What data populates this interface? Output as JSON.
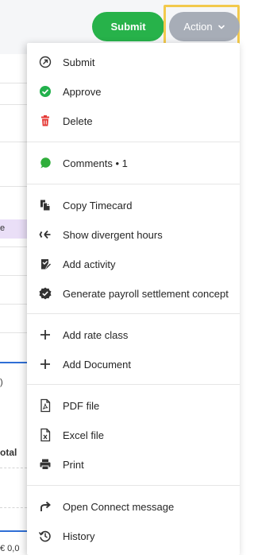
{
  "header": {
    "submit_label": "Submit",
    "action_label": "Action"
  },
  "background": {
    "fragment_e": "e",
    "fragment_zero": ")",
    "fragment_total": "otal",
    "fragment_euro": "€ 0,0"
  },
  "menu": {
    "items": [
      {
        "label": "Submit",
        "icon": "arrow-circle-icon"
      },
      {
        "label": "Approve",
        "icon": "check-circle-icon"
      },
      {
        "label": "Delete",
        "icon": "trash-icon"
      },
      {
        "label": "Comments • 1",
        "icon": "comment-icon"
      },
      {
        "label": "Copy Timecard",
        "icon": "copy-icon"
      },
      {
        "label": "Show divergent hours",
        "icon": "divergent-icon"
      },
      {
        "label": "Add activity",
        "icon": "add-activity-icon"
      },
      {
        "label": "Generate payroll settlement concept",
        "icon": "verified-badge-icon"
      },
      {
        "label": "Add rate class",
        "icon": "plus-icon"
      },
      {
        "label": "Add Document",
        "icon": "plus-icon"
      },
      {
        "label": "PDF file",
        "icon": "pdf-file-icon"
      },
      {
        "label": "Excel file",
        "icon": "excel-file-icon"
      },
      {
        "label": "Print",
        "icon": "print-icon"
      },
      {
        "label": "Open Connect message",
        "icon": "share-arrow-icon"
      },
      {
        "label": "History",
        "icon": "history-icon"
      }
    ]
  },
  "colors": {
    "submit_green": "#27b24a",
    "action_gray": "#a7adb7",
    "highlight_yellow": "#f2c94c",
    "approve_green": "#22b14c",
    "delete_red": "#e53935",
    "comment_green": "#2fae3b",
    "accent_blue": "#2f6fd6"
  }
}
